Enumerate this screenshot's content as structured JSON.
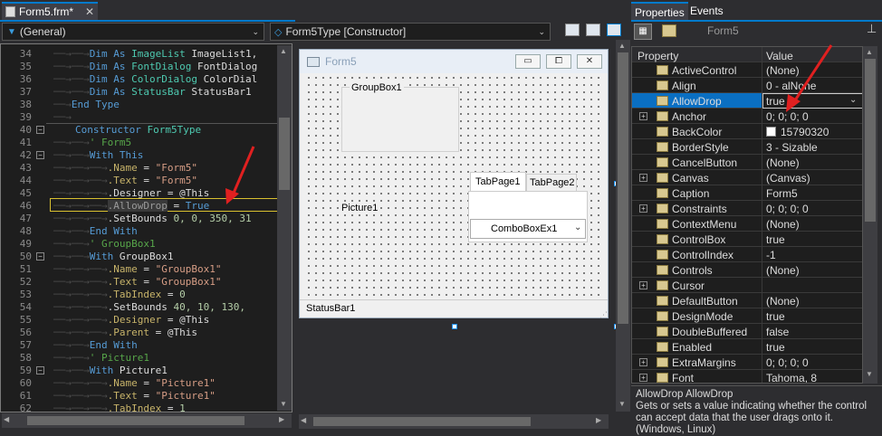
{
  "editor": {
    "tab_title": "Form5.frm*",
    "tab_close": "✕",
    "general_combo": "(General)",
    "member_combo": "Form5Type [Constructor]",
    "lines": [
      {
        "n": "34"
      },
      {
        "n": "35"
      },
      {
        "n": "36"
      },
      {
        "n": "37"
      },
      {
        "n": "38"
      },
      {
        "n": "39"
      },
      {
        "n": "40"
      },
      {
        "n": "41"
      },
      {
        "n": "42"
      },
      {
        "n": "43"
      },
      {
        "n": "44"
      },
      {
        "n": "45"
      },
      {
        "n": "46"
      },
      {
        "n": "47"
      },
      {
        "n": "48"
      },
      {
        "n": "49"
      },
      {
        "n": "50"
      },
      {
        "n": "51"
      },
      {
        "n": "52"
      },
      {
        "n": "53"
      },
      {
        "n": "54"
      },
      {
        "n": "55"
      },
      {
        "n": "56"
      },
      {
        "n": "57"
      },
      {
        "n": "58"
      },
      {
        "n": "59"
      },
      {
        "n": "60"
      },
      {
        "n": "61"
      },
      {
        "n": "62"
      }
    ],
    "code": {
      "l34": [
        "Dim As ",
        "ImageList",
        " ImageList1,"
      ],
      "l35": [
        "Dim As ",
        "FontDialog",
        " FontDialog"
      ],
      "l36": [
        "Dim As ",
        "ColorDialog",
        " ColorDial"
      ],
      "l37": [
        "Dim As ",
        "StatusBar",
        " StatusBar1"
      ],
      "l38": "End Type",
      "l40": [
        "Constructor ",
        "Form5Type"
      ],
      "l41": "' Form5",
      "l42": "With This",
      "l43": [
        ".Name",
        " = ",
        "\"Form5\""
      ],
      "l44": [
        ".Text",
        " = ",
        "\"Form5\""
      ],
      "l45": [
        ".Designer",
        " = @This"
      ],
      "l46": [
        ".AllowDrop",
        " = ",
        "True"
      ],
      "l47": [
        ".SetBounds ",
        "0, 0, 350, 31"
      ],
      "l48": "End With",
      "l49": "' GroupBox1",
      "l50": [
        "With ",
        "GroupBox1"
      ],
      "l51": [
        ".Name",
        " = ",
        "\"GroupBox1\""
      ],
      "l52": [
        ".Text",
        " = ",
        "\"GroupBox1\""
      ],
      "l53": [
        ".TabIndex",
        " = ",
        "0"
      ],
      "l54": [
        ".SetBounds ",
        "40, 10, 130,"
      ],
      "l55": [
        ".Designer",
        " = @This"
      ],
      "l56": [
        ".Parent",
        " = @This"
      ],
      "l57": "End With",
      "l58": "' Picture1",
      "l59": [
        "With ",
        "Picture1"
      ],
      "l60": [
        ".Name",
        " = ",
        "\"Picture1\""
      ],
      "l61": [
        ".Text",
        " = ",
        "\"Picture1\""
      ],
      "l62": [
        ".TabIndex",
        " = ",
        "1"
      ]
    }
  },
  "designer": {
    "form_title": "Form5",
    "groupbox_label": "GroupBox1",
    "picture_label": "Picture1",
    "tab1_label": "TabPage1",
    "tab2_label": "TabPage2",
    "combobox_label": "ComboBoxEx1",
    "statusbar_label": "StatusBar1",
    "minimize_glyph": "▭",
    "restore_glyph": "⧠",
    "close_glyph": "✕"
  },
  "properties": {
    "tab_properties": "Properties",
    "tab_events": "Events",
    "object_name": "Form5",
    "col_property": "Property",
    "col_value": "Value",
    "rows": [
      {
        "name": "ActiveControl",
        "value": "(None)",
        "expand": false
      },
      {
        "name": "Align",
        "value": "0 - alNone",
        "expand": false
      },
      {
        "name": "AllowDrop",
        "value": "true",
        "expand": false,
        "selected": true
      },
      {
        "name": "Anchor",
        "value": "0; 0; 0; 0",
        "expand": true
      },
      {
        "name": "BackColor",
        "value": "15790320",
        "expand": false,
        "swatch": "#ffffff"
      },
      {
        "name": "BorderStyle",
        "value": "3 - Sizable",
        "expand": false
      },
      {
        "name": "CancelButton",
        "value": "(None)",
        "expand": false
      },
      {
        "name": "Canvas",
        "value": "(Canvas)",
        "expand": true
      },
      {
        "name": "Caption",
        "value": "Form5",
        "expand": false
      },
      {
        "name": "Constraints",
        "value": "0; 0; 0; 0",
        "expand": true
      },
      {
        "name": "ContextMenu",
        "value": "(None)",
        "expand": false
      },
      {
        "name": "ControlBox",
        "value": "true",
        "expand": false
      },
      {
        "name": "ControlIndex",
        "value": "-1",
        "expand": false
      },
      {
        "name": "Controls",
        "value": "(None)",
        "expand": false
      },
      {
        "name": "Cursor",
        "value": "",
        "expand": true
      },
      {
        "name": "DefaultButton",
        "value": "(None)",
        "expand": false
      },
      {
        "name": "DesignMode",
        "value": "true",
        "expand": false
      },
      {
        "name": "DoubleBuffered",
        "value": "false",
        "expand": false
      },
      {
        "name": "Enabled",
        "value": "true",
        "expand": false
      },
      {
        "name": "ExtraMargins",
        "value": "0; 0; 0; 0",
        "expand": true
      },
      {
        "name": "Font",
        "value": "Tahoma, 8",
        "expand": true
      }
    ],
    "desc_title": "AllowDrop  AllowDrop",
    "desc_text": "Gets or sets a value indicating whether the control can accept data that the user drags onto it. (Windows, Linux)"
  },
  "colors": {
    "accent": "#007acc",
    "selection": "#0a6fc2",
    "annotation_arrow": "#e02020"
  }
}
